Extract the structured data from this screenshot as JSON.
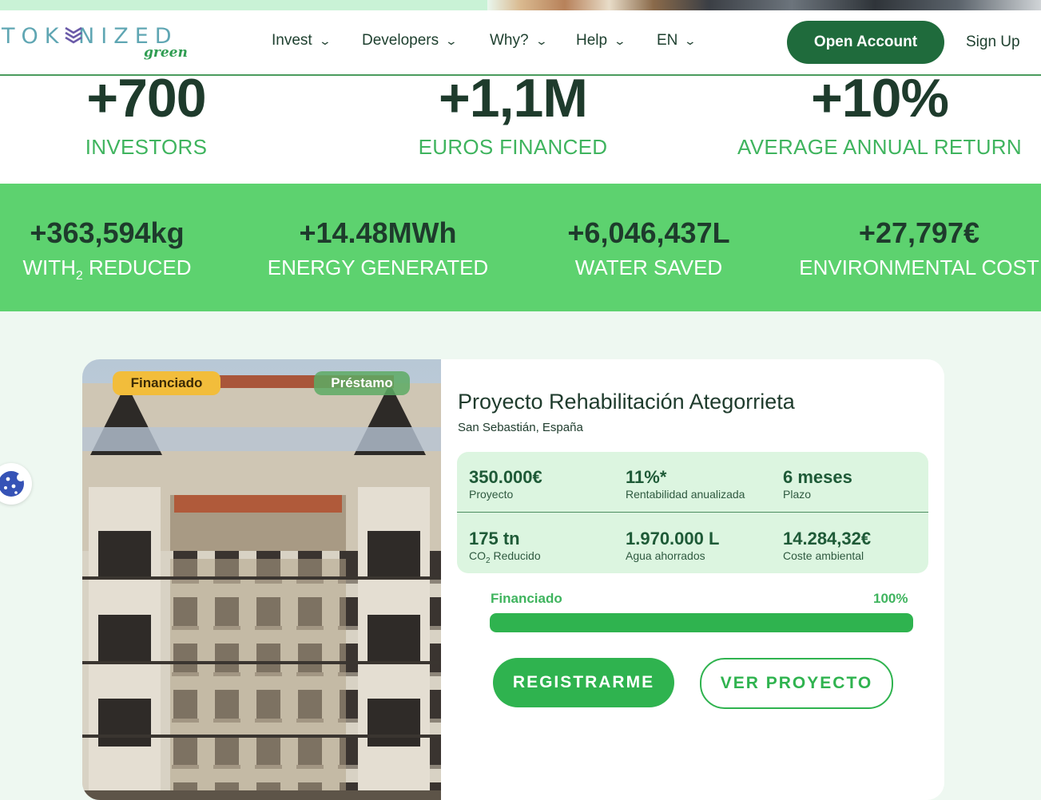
{
  "header": {
    "logo_word": "TOK  NIZED",
    "logo_sub": "green",
    "nav": [
      {
        "label": "Invest"
      },
      {
        "label": "Developers"
      },
      {
        "label": "Why?"
      },
      {
        "label": "Help"
      },
      {
        "label": "EN"
      }
    ],
    "open_account": "Open Account",
    "sign_up": "Sign Up"
  },
  "big_stats": [
    {
      "value": "+700",
      "label": "INVESTORS"
    },
    {
      "value": "+1,1M",
      "label": "EUROS FINANCED"
    },
    {
      "value": "+10%",
      "label": "AVERAGE ANNUAL RETURN"
    }
  ],
  "impact_stats": [
    {
      "value": "+363,594kg",
      "label_pre": "WITH",
      "label_sub": "2",
      "label_post": " REDUCED"
    },
    {
      "value": "+14.48MWh",
      "label": "ENERGY GENERATED"
    },
    {
      "value": "+6,046,437L",
      "label": "WATER SAVED"
    },
    {
      "value": "+27,797€",
      "label": "ENVIRONMENTAL COST"
    }
  ],
  "project": {
    "badge_status": "Financiado",
    "badge_type": "Préstamo",
    "title": "Proyecto Rehabilitación Ategorrieta",
    "location": "San Sebastián, España",
    "metrics": [
      {
        "value": "350.000€",
        "label": "Proyecto"
      },
      {
        "value": "11%*",
        "label": "Rentabilidad anualizada"
      },
      {
        "value": "6 meses",
        "label": "Plazo"
      },
      {
        "value": "175 tn",
        "label_pre": "CO",
        "label_sub": "2",
        "label_post": " Reducido"
      },
      {
        "value": "1.970.000 L",
        "label": "Agua ahorrados"
      },
      {
        "value": "14.284,32€",
        "label": "Coste ambiental"
      }
    ],
    "progress_label": "Financiado",
    "progress_text": "100%",
    "progress_fraction": 1.0,
    "register_button": "REGISTRARME",
    "view_button": "VER PROYECTO"
  },
  "colors": {
    "dark_green": "#1f6b3c",
    "accent_green": "#3fb45e",
    "band_green": "#5dd26f",
    "badge_yellow": "#f2bd3b"
  },
  "icons": {
    "cookie": "cookie-icon",
    "logo_mark": "chevron-stack-icon",
    "nav_dropdown": "chevron-down-icon"
  }
}
